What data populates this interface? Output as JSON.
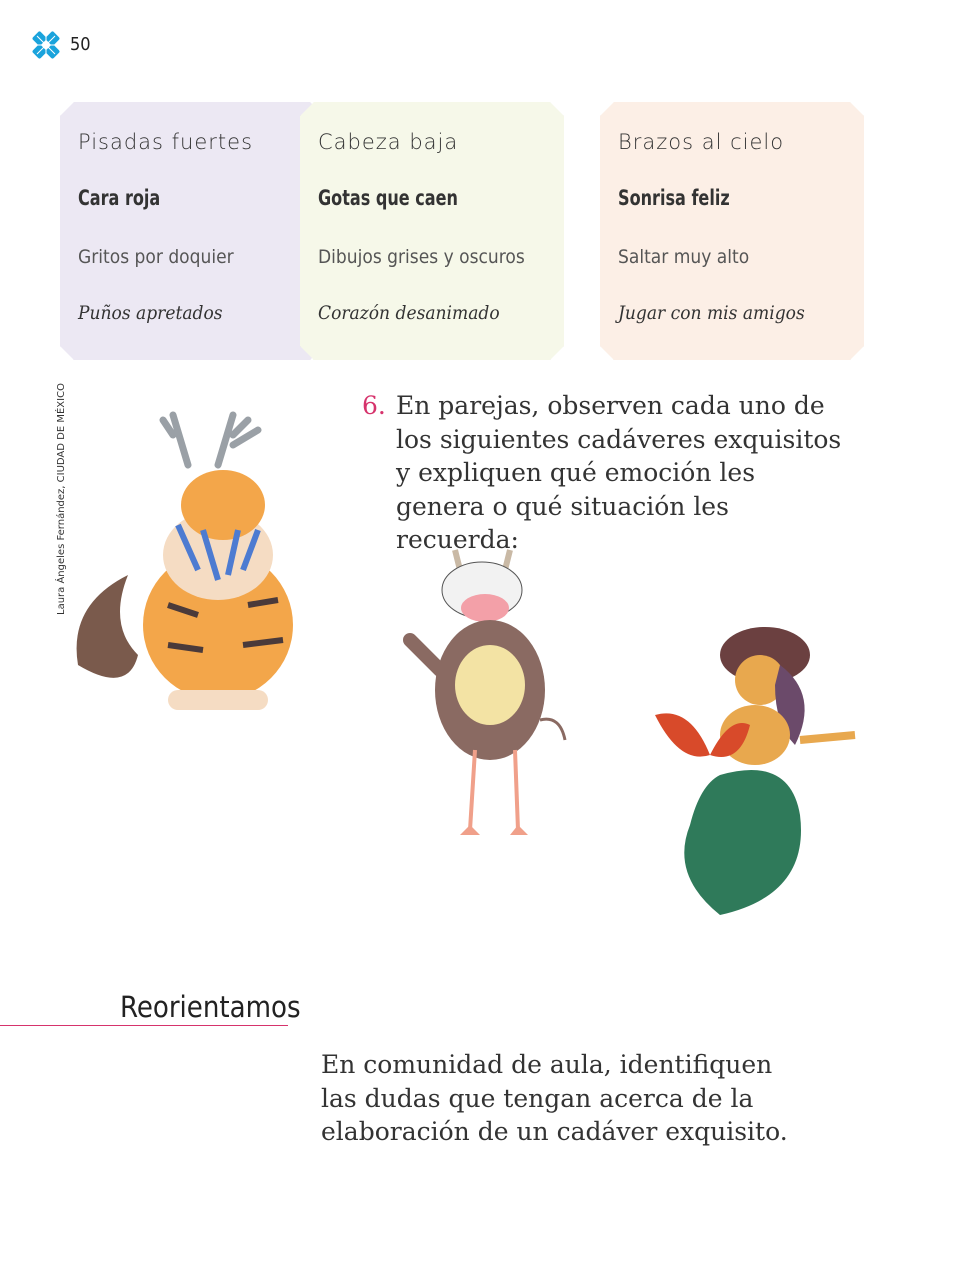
{
  "page_number": "50",
  "header": {
    "logo_icon": "flower-logo-icon",
    "logo_color": "#1aa3dc"
  },
  "cards": [
    {
      "color": "#ece8f3",
      "lines": [
        "Pisadas fuertes",
        "Cara roja",
        "Gritos por doquier",
        "Puños apretados"
      ]
    },
    {
      "color": "#f6f8e9",
      "lines": [
        "Cabeza baja",
        "Gotas que caen",
        "Dibujos grises y oscuros",
        "Corazón desanimado"
      ]
    },
    {
      "color": "#fcefe6",
      "lines": [
        "Brazos al cielo",
        "Sonrisa feliz",
        "Saltar muy alto",
        "Jugar con mis amigos"
      ]
    }
  ],
  "credit": "Laura Ángeles Fernández, CIUDAD DE MÉXICO",
  "activity": {
    "number": "6.",
    "text": "En parejas, observen cada uno de los siguientes cadáveres exquisitos y expliquen qué emoción les genera o qué situación les recuerda:",
    "number_color": "#d6336c"
  },
  "section": {
    "title": "Reorientamos",
    "text": "En comunidad de aula, identifiquen las dudas que tengan acerca de la elaboración de un cadáver exquisito."
  }
}
